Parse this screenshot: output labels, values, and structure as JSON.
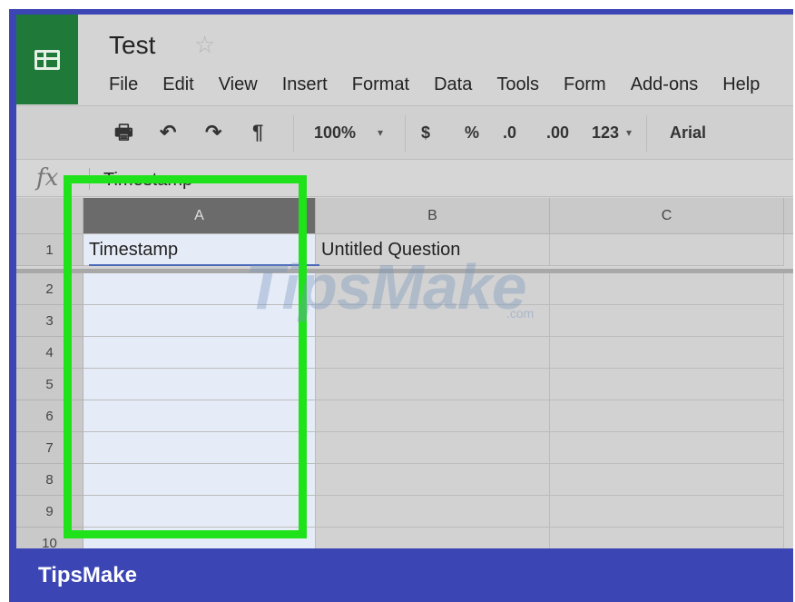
{
  "header": {
    "title": "Test",
    "menu": [
      "File",
      "Edit",
      "View",
      "Insert",
      "Format",
      "Data",
      "Tools",
      "Form",
      "Add-ons",
      "Help"
    ]
  },
  "toolbar": {
    "zoom": "100%",
    "currency": "$",
    "percent": "%",
    "decrease_decimal": ".0",
    "increase_decimal": ".00",
    "more_formats": "123",
    "font": "Arial"
  },
  "formula_bar": {
    "fx": "fx",
    "value": "Timestamp"
  },
  "grid": {
    "columns": [
      "A",
      "B",
      "C"
    ],
    "rows": [
      "1",
      "2",
      "3",
      "4",
      "5",
      "6",
      "7",
      "8",
      "9",
      "10"
    ],
    "row1": {
      "A": "Timestamp",
      "B": "Untitled Question",
      "C": ""
    }
  },
  "watermark": {
    "text": "TipsMake",
    "suffix": ".com"
  },
  "footer": {
    "brand": "TipsMake"
  },
  "colors": {
    "frame": "#3b45b4",
    "highlight": "#1fe21b",
    "logo": "#1f7a3a"
  }
}
